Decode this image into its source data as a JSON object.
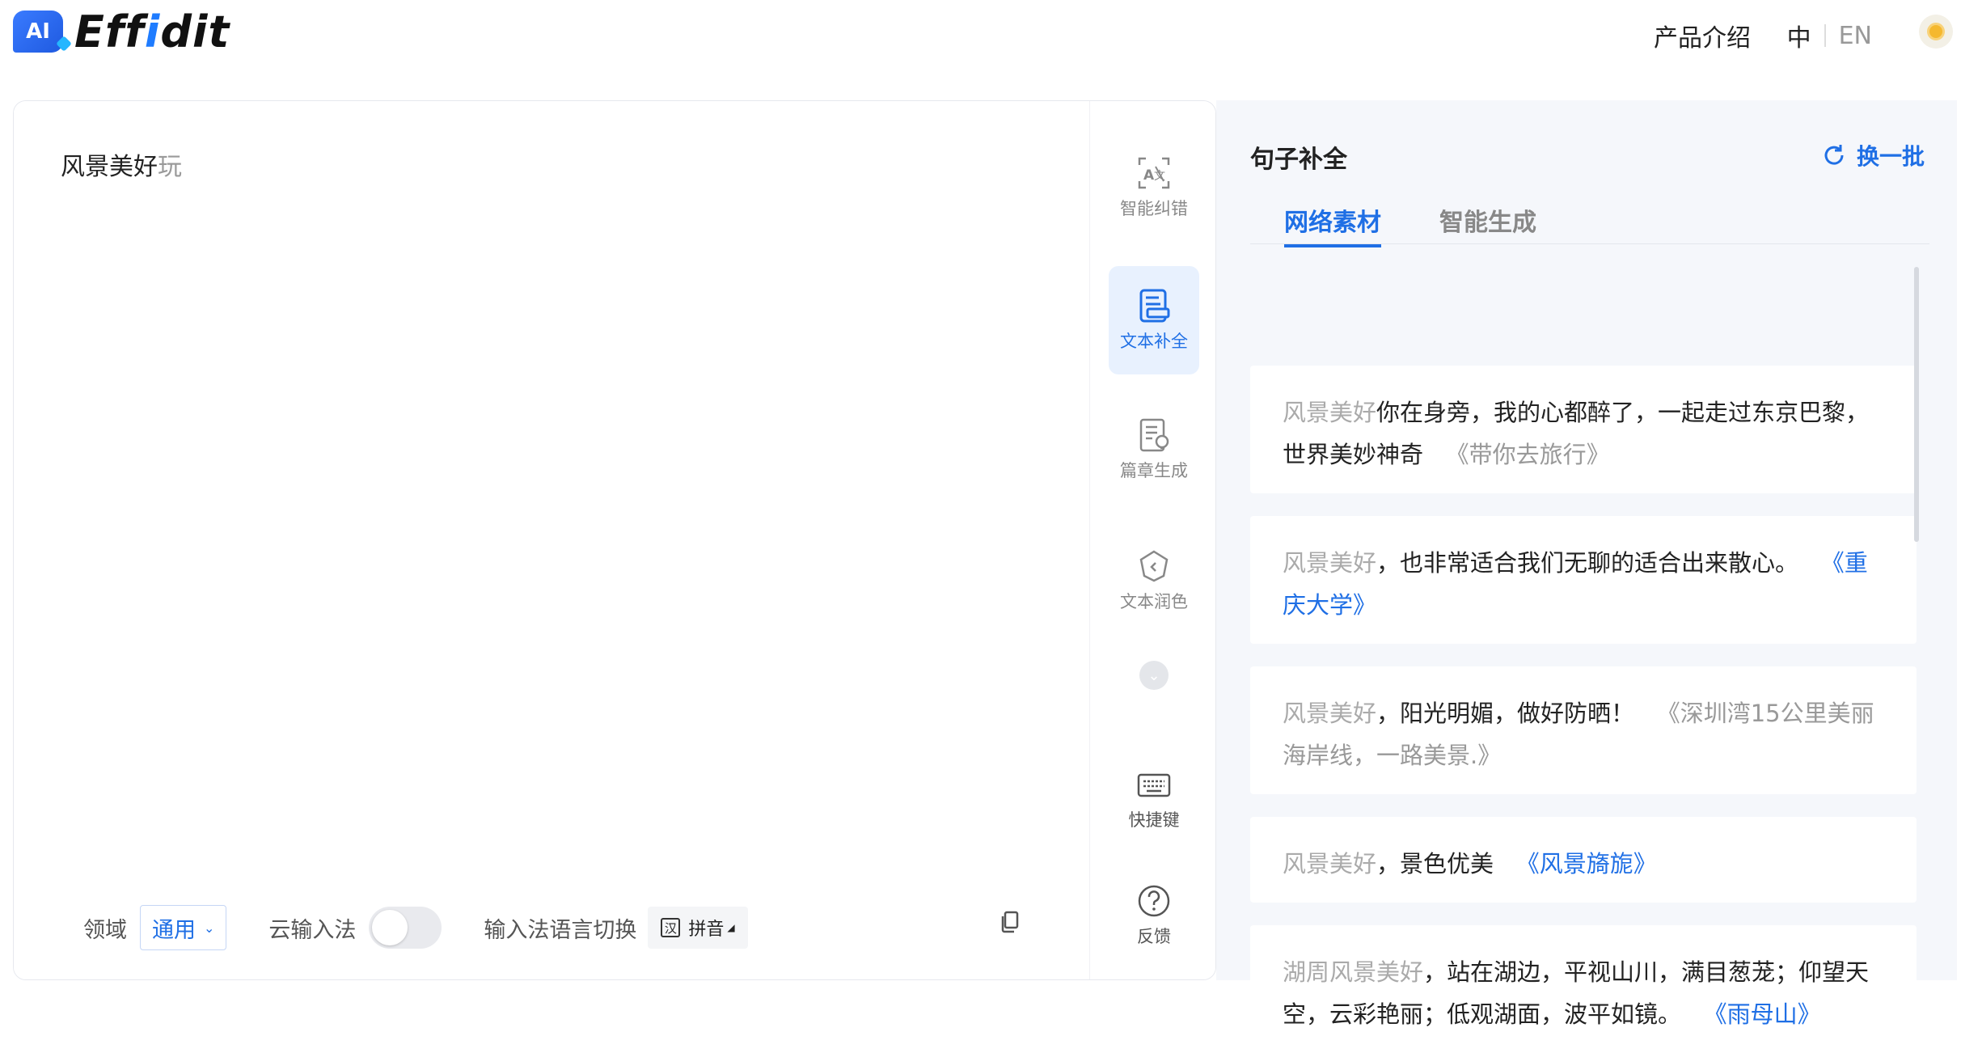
{
  "header": {
    "logo_badge": "AI",
    "logo_prefix": "Eff",
    "logo_i": "i",
    "logo_suffix": "dit",
    "nav_product": "产品介绍",
    "lang_zh": "中",
    "lang_en": "EN"
  },
  "editor": {
    "text": "风景美好",
    "suggestion": "玩"
  },
  "bottom_bar": {
    "domain_label": "领域",
    "domain_value": "通用",
    "cloud_ime_label": "云输入法",
    "cloud_ime_enabled": false,
    "ime_switch_label": "输入法语言切换",
    "ime_icon_char": "汉",
    "ime_value": "拼音"
  },
  "tools": {
    "correction": "智能纠错",
    "completion": "文本补全",
    "article": "篇章生成",
    "polish": "文本润色",
    "shortcuts": "快捷键",
    "feedback": "反馈",
    "active": "completion"
  },
  "panel": {
    "title": "句子补全",
    "refresh": "换一批",
    "tabs": [
      "网络素材",
      "智能生成"
    ],
    "active_tab": 0,
    "results": [
      {
        "prefix": "风景美好",
        "body": "你在身旁，我的心都醉了，一起走过东京巴黎，世界美妙神奇",
        "source": "《带你去旅行》",
        "source_style": "grey"
      },
      {
        "prefix": "风景美好",
        "body": "，也非常适合我们无聊的适合出来散心。",
        "source": "《重庆大学》",
        "source_style": "blue"
      },
      {
        "prefix": "风景美好",
        "body": "，阳光明媚，做好防晒！",
        "source": "《深圳湾15公里美丽海岸线，一路美景.》",
        "source_style": "grey"
      },
      {
        "prefix": "风景美好",
        "body": "，景色优美",
        "source": "《风景旖旎》",
        "source_style": "blue"
      },
      {
        "prefix": "湖周风景美好",
        "body": "，站在湖边，平视山川，满目葱茏；仰望天空，云彩艳丽；低观湖面，波平如镜。",
        "source": "《雨母山》",
        "source_style": "blue"
      }
    ]
  },
  "colors": {
    "accent": "#1f6fe5",
    "panel_bg": "#f5f7fb"
  }
}
